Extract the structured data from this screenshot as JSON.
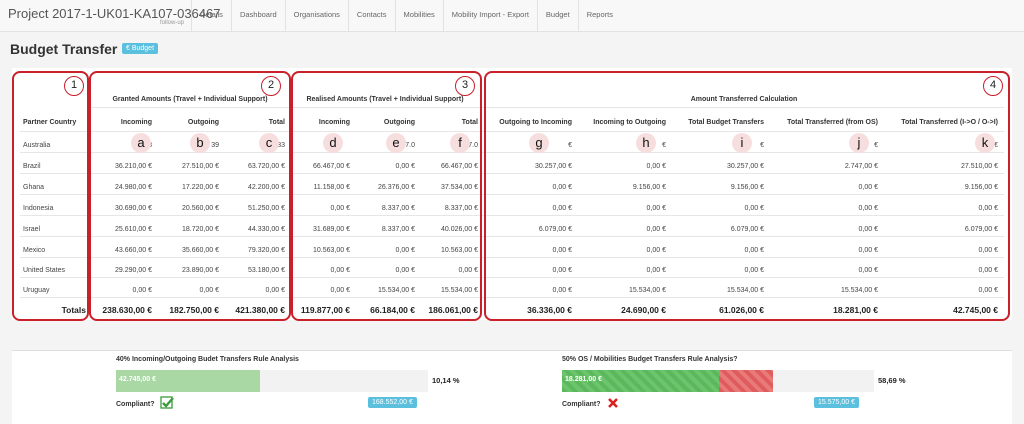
{
  "nav": {
    "brand": "Project 2017-1-UK01-KA107-036467",
    "brand_sub": "follow-up",
    "items": [
      "Details",
      "Dashboard",
      "Organisations",
      "Contacts",
      "Mobilities",
      "Mobility Import - Export",
      "Budget",
      "Reports"
    ]
  },
  "page": {
    "title": "Budget Transfer",
    "badge": "€ Budget"
  },
  "table": {
    "group_numbers": [
      "1",
      "2",
      "3",
      "4"
    ],
    "groups": [
      "Granted Amounts (Travel + Individual Support)",
      "Realised Amounts (Travel + Individual Support)",
      "Amount Transferred Calculation"
    ],
    "partner_header": "Partner Country",
    "columns": [
      "Incoming",
      "Outgoing",
      "Total",
      "Incoming",
      "Outgoing",
      "Total",
      "Outgoing to Incoming",
      "Incoming to Outgoing",
      "Total Budget Transfers",
      "Total Transferred (from OS)",
      "Total Transferred (I->O / O->I)"
    ],
    "column_letters": [
      "a",
      "b",
      "c",
      "d",
      "e",
      "f",
      "g",
      "h",
      "i",
      "j",
      "k"
    ],
    "rows": [
      {
        "country": "Australia",
        "values": [
          "48",
          "39",
          "87.33",
          "",
          "7.0",
          "7.0",
          "",
          "",
          "",
          "",
          ""
        ],
        "suffix": [
          "",
          "",
          "",
          "",
          "",
          "",
          "€",
          "€",
          "€",
          "€",
          "€"
        ]
      },
      {
        "country": "Brazil",
        "values": [
          "36.210,00 €",
          "27.510,00 €",
          "63.720,00 €",
          "66.467,00 €",
          "0,00 €",
          "66.467,00 €",
          "30.257,00 €",
          "0,00 €",
          "30.257,00 €",
          "2.747,00 €",
          "27.510,00 €"
        ]
      },
      {
        "country": "Ghana",
        "values": [
          "24.980,00 €",
          "17.220,00 €",
          "42.200,00 €",
          "11.158,00 €",
          "26.376,00 €",
          "37.534,00 €",
          "0,00 €",
          "9.156,00 €",
          "9.156,00 €",
          "0,00 €",
          "9.156,00 €"
        ]
      },
      {
        "country": "Indonesia",
        "values": [
          "30.690,00 €",
          "20.560,00 €",
          "51.250,00 €",
          "0,00 €",
          "8.337,00 €",
          "8.337,00 €",
          "0,00 €",
          "0,00 €",
          "0,00 €",
          "0,00 €",
          "0,00 €"
        ]
      },
      {
        "country": "Israel",
        "values": [
          "25.610,00 €",
          "18.720,00 €",
          "44.330,00 €",
          "31.689,00 €",
          "8.337,00 €",
          "40.026,00 €",
          "6.079,00 €",
          "0,00 €",
          "6.079,00 €",
          "0,00 €",
          "6.079,00 €"
        ]
      },
      {
        "country": "Mexico",
        "values": [
          "43.660,00 €",
          "35.660,00 €",
          "79.320,00 €",
          "10.563,00 €",
          "0,00 €",
          "10.563,00 €",
          "0,00 €",
          "0,00 €",
          "0,00 €",
          "0,00 €",
          "0,00 €"
        ]
      },
      {
        "country": "United States",
        "values": [
          "29.290,00 €",
          "23.890,00 €",
          "53.180,00 €",
          "0,00 €",
          "0,00 €",
          "0,00 €",
          "0,00 €",
          "0,00 €",
          "0,00 €",
          "0,00 €",
          "0,00 €"
        ]
      },
      {
        "country": "Uruguay",
        "values": [
          "0,00 €",
          "0,00 €",
          "0,00 €",
          "0,00 €",
          "15.534,00 €",
          "15.534,00 €",
          "0,00 €",
          "15.534,00 €",
          "15.534,00 €",
          "15.534,00 €",
          "0,00 €"
        ]
      }
    ],
    "totals_label": "Totals",
    "totals": [
      "238.630,00 €",
      "182.750,00 €",
      "421.380,00 €",
      "119.877,00 €",
      "66.184,00 €",
      "186.061,00 €",
      "36.336,00 €",
      "24.690,00 €",
      "61.026,00 €",
      "18.281,00 €",
      "42.745,00 €"
    ]
  },
  "rules": [
    {
      "title": "40% Incoming/Outgoing Budet Transfers Rule Analysis",
      "bar_value": "42.745,00 €",
      "fill_fraction": 0.46,
      "fill_color": "#a9d8a5",
      "percent": "10,14 %",
      "compliant_label": "Compliant?",
      "compliant": true,
      "badge": "168.552,00 €"
    },
    {
      "title": "50% OS / Mobilities Budget Transfers Rule Analysis?",
      "bar_value": "18.281,00 €",
      "fill_fraction": 0.59,
      "fill_color": "#5cb85c",
      "over_color": "#e05c5c",
      "over_start": 0.5,
      "percent": "58,69 %",
      "compliant_label": "Compliant?",
      "compliant": false,
      "badge": "15.575,00 €"
    }
  ],
  "colors": {
    "outline": "#c9202a",
    "badge": "#5bc0de",
    "ok": "#3c9a3c",
    "fail": "#d9211e"
  }
}
